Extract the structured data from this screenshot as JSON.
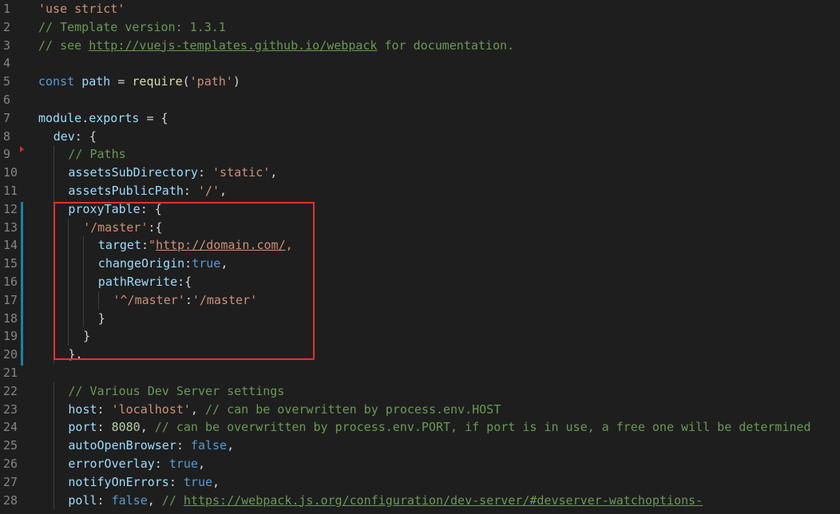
{
  "editor": {
    "language": "javascript",
    "colors": {
      "background": "#1e1e1e",
      "line_number": "#858585",
      "keyword": "#569cd6",
      "string": "#ce9178",
      "comment": "#6a9955",
      "property": "#9cdcfe",
      "function": "#dcdcaa",
      "number": "#b5cea8",
      "plain": "#d4d4d4",
      "annotation_box": "#e0342e",
      "modified_bar": "#1b81a8"
    },
    "lines": [
      {
        "number": "1",
        "indent": 0,
        "tokens": [
          {
            "t": "'use strict'",
            "c": "str"
          }
        ]
      },
      {
        "number": "2",
        "indent": 0,
        "tokens": [
          {
            "t": "// Template version: 1.3.1",
            "c": "cm"
          }
        ]
      },
      {
        "number": "3",
        "indent": 0,
        "tokens": [
          {
            "t": "// see ",
            "c": "cm"
          },
          {
            "t": "http://vuejs-templates.github.io/webpack",
            "c": "cm",
            "link": true
          },
          {
            "t": " for documentation.",
            "c": "cm"
          }
        ]
      },
      {
        "number": "4",
        "indent": 0,
        "tokens": []
      },
      {
        "number": "5",
        "indent": 0,
        "tokens": [
          {
            "t": "const ",
            "c": "kw"
          },
          {
            "t": "path",
            "c": "prop"
          },
          {
            "t": " = ",
            "c": "pl"
          },
          {
            "t": "require",
            "c": "fn"
          },
          {
            "t": "(",
            "c": "pl"
          },
          {
            "t": "'path'",
            "c": "str"
          },
          {
            "t": ")",
            "c": "pl"
          }
        ]
      },
      {
        "number": "6",
        "indent": 0,
        "tokens": []
      },
      {
        "number": "7",
        "indent": 0,
        "tokens": [
          {
            "t": "module",
            "c": "prop"
          },
          {
            "t": ".",
            "c": "pl"
          },
          {
            "t": "exports",
            "c": "prop"
          },
          {
            "t": " = {",
            "c": "pl"
          }
        ]
      },
      {
        "number": "8",
        "indent": 1,
        "tokens": [
          {
            "t": "dev",
            "c": "prop"
          },
          {
            "t": ": {",
            "c": "pl"
          }
        ]
      },
      {
        "number": "9",
        "indent": 2,
        "tokens": [
          {
            "t": "// Paths",
            "c": "cm"
          }
        ]
      },
      {
        "number": "10",
        "indent": 2,
        "tokens": [
          {
            "t": "assetsSubDirectory",
            "c": "prop"
          },
          {
            "t": ": ",
            "c": "pl"
          },
          {
            "t": "'static'",
            "c": "str"
          },
          {
            "t": ",",
            "c": "pl"
          }
        ]
      },
      {
        "number": "11",
        "indent": 2,
        "tokens": [
          {
            "t": "assetsPublicPath",
            "c": "prop"
          },
          {
            "t": ": ",
            "c": "pl"
          },
          {
            "t": "'/'",
            "c": "str"
          },
          {
            "t": ",",
            "c": "pl"
          }
        ]
      },
      {
        "number": "12",
        "indent": 2,
        "tokens": [
          {
            "t": "proxyTable",
            "c": "prop"
          },
          {
            "t": ": {",
            "c": "pl"
          }
        ]
      },
      {
        "number": "13",
        "indent": 3,
        "tokens": [
          {
            "t": "'/master'",
            "c": "str"
          },
          {
            "t": ":{",
            "c": "pl"
          }
        ]
      },
      {
        "number": "14",
        "indent": 4,
        "tokens": [
          {
            "t": "target",
            "c": "prop"
          },
          {
            "t": ":",
            "c": "pl"
          },
          {
            "t": "\"",
            "c": "str"
          },
          {
            "t": "http://domain.com/",
            "c": "str",
            "link": true
          },
          {
            "t": ",",
            "c": "str"
          }
        ]
      },
      {
        "number": "15",
        "indent": 4,
        "tokens": [
          {
            "t": "changeOrigin",
            "c": "prop"
          },
          {
            "t": ":",
            "c": "pl"
          },
          {
            "t": "true",
            "c": "kw"
          },
          {
            "t": ",",
            "c": "pl"
          }
        ]
      },
      {
        "number": "16",
        "indent": 4,
        "tokens": [
          {
            "t": "pathRewrite",
            "c": "prop"
          },
          {
            "t": ":{",
            "c": "pl"
          }
        ]
      },
      {
        "number": "17",
        "indent": 5,
        "tokens": [
          {
            "t": "'^/master'",
            "c": "str"
          },
          {
            "t": ":",
            "c": "pl"
          },
          {
            "t": "'/master'",
            "c": "str"
          }
        ]
      },
      {
        "number": "18",
        "indent": 4,
        "tokens": [
          {
            "t": "}",
            "c": "pl"
          }
        ]
      },
      {
        "number": "19",
        "indent": 3,
        "tokens": [
          {
            "t": "}",
            "c": "pl"
          }
        ]
      },
      {
        "number": "20",
        "indent": 2,
        "tokens": [
          {
            "t": "},",
            "c": "pl"
          }
        ]
      },
      {
        "number": "21",
        "indent": 0,
        "tokens": []
      },
      {
        "number": "22",
        "indent": 2,
        "tokens": [
          {
            "t": "// Various Dev Server settings",
            "c": "cm"
          }
        ]
      },
      {
        "number": "23",
        "indent": 2,
        "tokens": [
          {
            "t": "host",
            "c": "prop"
          },
          {
            "t": ": ",
            "c": "pl"
          },
          {
            "t": "'localhost'",
            "c": "str"
          },
          {
            "t": ", ",
            "c": "pl"
          },
          {
            "t": "// can be overwritten by process.env.HOST",
            "c": "cm"
          }
        ]
      },
      {
        "number": "24",
        "indent": 2,
        "tokens": [
          {
            "t": "port",
            "c": "prop"
          },
          {
            "t": ": ",
            "c": "pl"
          },
          {
            "t": "8080",
            "c": "num"
          },
          {
            "t": ", ",
            "c": "pl"
          },
          {
            "t": "// can be overwritten by process.env.PORT, if port is in use, a free one will be determined",
            "c": "cm"
          }
        ]
      },
      {
        "number": "25",
        "indent": 2,
        "tokens": [
          {
            "t": "autoOpenBrowser",
            "c": "prop"
          },
          {
            "t": ": ",
            "c": "pl"
          },
          {
            "t": "false",
            "c": "kw"
          },
          {
            "t": ",",
            "c": "pl"
          }
        ]
      },
      {
        "number": "26",
        "indent": 2,
        "tokens": [
          {
            "t": "errorOverlay",
            "c": "prop"
          },
          {
            "t": ": ",
            "c": "pl"
          },
          {
            "t": "true",
            "c": "kw"
          },
          {
            "t": ",",
            "c": "pl"
          }
        ]
      },
      {
        "number": "27",
        "indent": 2,
        "tokens": [
          {
            "t": "notifyOnErrors",
            "c": "prop"
          },
          {
            "t": ": ",
            "c": "pl"
          },
          {
            "t": "true",
            "c": "kw"
          },
          {
            "t": ",",
            "c": "pl"
          }
        ]
      },
      {
        "number": "28",
        "indent": 2,
        "tokens": [
          {
            "t": "poll",
            "c": "prop"
          },
          {
            "t": ": ",
            "c": "pl"
          },
          {
            "t": "false",
            "c": "kw"
          },
          {
            "t": ", ",
            "c": "pl"
          },
          {
            "t": "// ",
            "c": "cm"
          },
          {
            "t": "https://webpack.js.org/configuration/dev-server/#devserver-watchoptions-",
            "c": "cm",
            "link": true
          }
        ]
      }
    ]
  }
}
